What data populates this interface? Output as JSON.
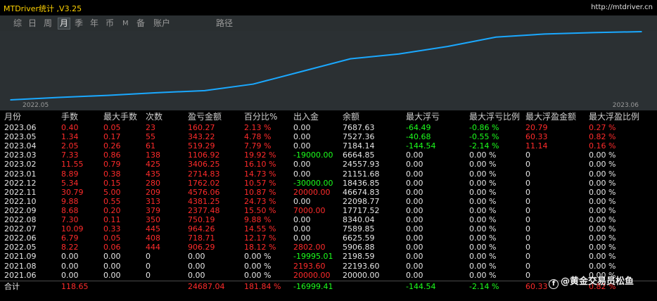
{
  "app": {
    "title": "MTDriver统计 ,V3.25",
    "url": "http://mtdriver.cn"
  },
  "tabs": [
    {
      "label": "综",
      "small": false
    },
    {
      "label": "日",
      "small": false
    },
    {
      "label": "周",
      "small": false
    },
    {
      "label": "月",
      "small": false,
      "active": true
    },
    {
      "label": "季",
      "small": false
    },
    {
      "label": "年",
      "small": false
    },
    {
      "label": "币",
      "small": false
    },
    {
      "label": "M",
      "small": true
    },
    {
      "label": "备",
      "small": false
    },
    {
      "label": "账户",
      "small": false
    },
    {
      "label": "路径",
      "small": false
    }
  ],
  "chart_data": {
    "type": "line",
    "x_start_label": "2022.05",
    "x_end_label": "2023.06",
    "line_color": "#1aa8ff",
    "x": [
      "2022.05",
      "2022.06",
      "2022.07",
      "2022.08",
      "2022.09",
      "2022.10",
      "2022.11",
      "2022.12",
      "2023.01",
      "2023.02",
      "2023.03",
      "2023.04",
      "2023.05",
      "2023.06"
    ],
    "values": [
      0,
      906.29,
      1624.99,
      2589.25,
      3339.44,
      5716.92,
      10298.17,
      14874.23,
      16636.25,
      19350.08,
      22756.33,
      23862.25,
      24381.54,
      24724.81
    ]
  },
  "columns": [
    "月份",
    "手数",
    "最大手数",
    "次数",
    "盈亏金额",
    "百分比%",
    "出入金",
    "余额",
    "最大浮亏",
    "最大浮亏比例",
    "最大浮盈金额",
    "最大浮盈比例"
  ],
  "rows": [
    [
      "2023.06",
      "0.40",
      "0.05",
      "23",
      "160.27",
      "2.13 %",
      "0.00",
      "7687.63",
      "-64.49",
      "-0.86 %",
      "20.79",
      "0.27 %"
    ],
    [
      "2023.05",
      "1.34",
      "0.17",
      "55",
      "343.22",
      "4.78 %",
      "0.00",
      "7527.36",
      "-40.68",
      "-0.55 %",
      "60.33",
      "0.82 %"
    ],
    [
      "2023.04",
      "2.05",
      "0.26",
      "61",
      "519.29",
      "7.79 %",
      "0.00",
      "7184.14",
      "-144.54",
      "-2.14 %",
      "11.14",
      "0.16 %"
    ],
    [
      "2023.03",
      "7.33",
      "0.86",
      "138",
      "1106.92",
      "19.92 %",
      "-19000.00",
      "6664.85",
      "0.00",
      "0.00 %",
      "0",
      "0.00 %"
    ],
    [
      "2023.02",
      "11.55",
      "0.79",
      "425",
      "3406.25",
      "16.10 %",
      "0.00",
      "24557.93",
      "0.00",
      "0.00 %",
      "0",
      "0.00 %"
    ],
    [
      "2023.01",
      "8.89",
      "0.38",
      "435",
      "2714.83",
      "14.73 %",
      "0.00",
      "21151.68",
      "0.00",
      "0.00 %",
      "0",
      "0.00 %"
    ],
    [
      "2022.12",
      "5.34",
      "0.15",
      "280",
      "1762.02",
      "10.57 %",
      "-30000.00",
      "18436.85",
      "0.00",
      "0.00 %",
      "0",
      "0.00 %"
    ],
    [
      "2022.11",
      "30.79",
      "5.00",
      "209",
      "4576.06",
      "10.87 %",
      "20000.00",
      "46674.83",
      "0.00",
      "0.00 %",
      "0",
      "0.00 %"
    ],
    [
      "2022.10",
      "9.88",
      "0.55",
      "313",
      "4381.25",
      "24.73 %",
      "0.00",
      "22098.77",
      "0.00",
      "0.00 %",
      "0",
      "0.00 %"
    ],
    [
      "2022.09",
      "8.68",
      "0.20",
      "379",
      "2377.48",
      "15.50 %",
      "7000.00",
      "17717.52",
      "0.00",
      "0.00 %",
      "0",
      "0.00 %"
    ],
    [
      "2022.08",
      "7.30",
      "0.11",
      "350",
      "750.19",
      "9.88 %",
      "0.00",
      "8340.04",
      "0.00",
      "0.00 %",
      "0",
      "0.00 %"
    ],
    [
      "2022.07",
      "10.09",
      "0.33",
      "445",
      "964.26",
      "14.55 %",
      "0.00",
      "7589.85",
      "0.00",
      "0.00 %",
      "0",
      "0.00 %"
    ],
    [
      "2022.06",
      "6.79",
      "0.05",
      "408",
      "718.71",
      "12.17 %",
      "0.00",
      "6625.59",
      "0.00",
      "0.00 %",
      "0",
      "0.00 %"
    ],
    [
      "2022.05",
      "8.22",
      "0.06",
      "444",
      "906.29",
      "18.12 %",
      "2802.00",
      "5906.88",
      "0.00",
      "0.00 %",
      "0",
      "0.00 %"
    ],
    [
      "2021.09",
      "0.00",
      "0.00",
      "0",
      "0.00",
      "0.00 %",
      "-19995.01",
      "2198.59",
      "0.00",
      "0.00 %",
      "0",
      "0.00 %"
    ],
    [
      "2021.08",
      "0.00",
      "0.00",
      "0",
      "0.00",
      "0.00 %",
      "2193.60",
      "22193.60",
      "0.00",
      "0.00 %",
      "0",
      "0.00 %"
    ],
    [
      "2021.06",
      "0.00",
      "0.00",
      "0",
      "0.00",
      "0.00 %",
      "20000.00",
      "20000.00",
      "0.00",
      "0.00 %",
      "0",
      "0.00 %"
    ]
  ],
  "total": [
    "合计",
    "118.65",
    "",
    "",
    "24687.04",
    "181.84 %",
    "-16999.41",
    "",
    "-144.54",
    "-2.14 %",
    "60.33",
    "0.82 %"
  ],
  "watermark": "@黄金交易员松鱼",
  "colors": {
    "positive": "#ff2b2b",
    "negative": "#1cff1c",
    "neutral": "#e6e6e6",
    "title": "#ffd200"
  }
}
